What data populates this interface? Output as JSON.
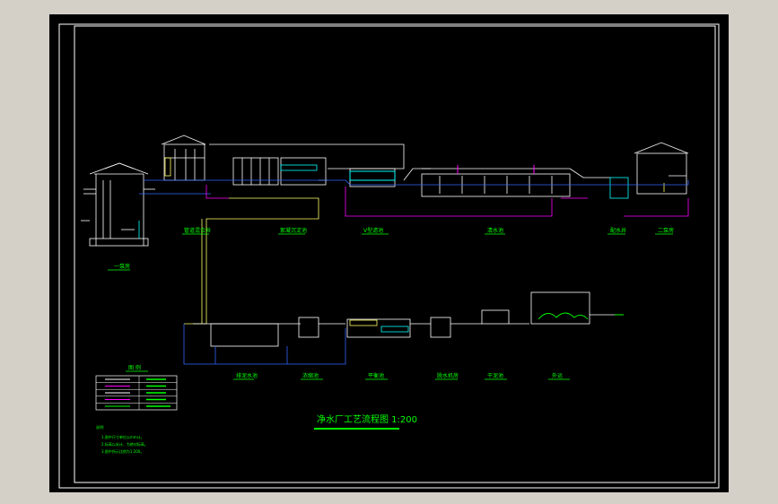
{
  "title": "净水厂工艺流程图 1:200",
  "labels_top": {
    "pump1": "一泵房",
    "mixing": "管道混合井",
    "sedimentation": "絮凝沉淀池",
    "filter": "V型滤池",
    "clearwell": "清水池",
    "distribution": "配水井",
    "pump2": "二泵房"
  },
  "labels_bottom": {
    "b1": "排泥水池",
    "b2": "浓缩池",
    "b3": "平衡池",
    "b4": "脱水机房",
    "b5": "干泥池",
    "b6": "外运"
  },
  "legend": {
    "heading": "图 例",
    "rows": [
      {
        "color": "#ffffff",
        "name": ""
      },
      {
        "color": "#ff00ff",
        "name": ""
      },
      {
        "color": "#ffffff",
        "name": ""
      },
      {
        "color": "#ff00ff",
        "name": ""
      },
      {
        "color": "#00ff00",
        "name": ""
      }
    ]
  },
  "notes": {
    "heading": "说明:",
    "lines": [
      "1.图中尺寸单位以mm计。",
      "2.标高以米计，为绝对标高。",
      "3.图中所示比例为1:200。"
    ]
  },
  "colors": {
    "frame": "#ffffff",
    "water_line": "#3366ff",
    "sludge_line": "#ff00ff",
    "drain_line": "#ffff66",
    "text": "#00ff00",
    "cyan": "#00ffff"
  }
}
